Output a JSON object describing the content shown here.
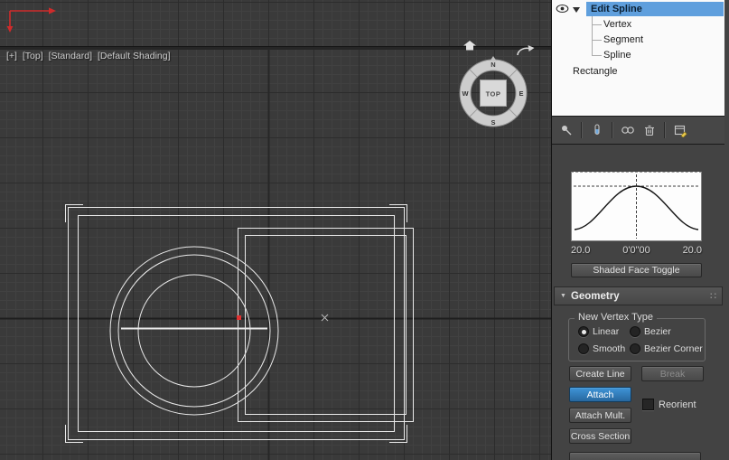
{
  "colors": {
    "viewport_bg": "#3a3a3a",
    "panel_bg": "#434343",
    "selection_blue": "#5f9fdd",
    "active_button_blue": "#2f7cbe",
    "wireframe": "#e9e9e9",
    "vertex_red": "#e03131"
  },
  "viewport": {
    "label_segments": [
      "[+]",
      "[Top]",
      "[Standard]",
      "[Default Shading]"
    ],
    "viewcube": {
      "face": "TOP",
      "west": "W",
      "east": "E",
      "south": "S",
      "north": "N"
    }
  },
  "modifier_stack": {
    "items": [
      {
        "label": "Edit Spline"
      },
      {
        "label": "Vertex"
      },
      {
        "label": "Segment"
      },
      {
        "label": "Spline"
      },
      {
        "label": "Rectangle"
      }
    ],
    "selected": "Edit Spline",
    "toolbar_icons": [
      "pin-stack",
      "show-end-result",
      "make-unique",
      "remove-modifier",
      "configure-modifier-sets"
    ]
  },
  "soft_selection": {
    "falloff_left": "20.0",
    "falloff_center": "0'0\"00",
    "falloff_right": "20.0",
    "shaded_face_toggle": "Shaded Face Toggle"
  },
  "geometry": {
    "title": "Geometry",
    "new_vertex_type": {
      "label": "New Vertex Type",
      "options": [
        "Linear",
        "Bezier",
        "Smooth",
        "Bezier Corner"
      ],
      "selected": "Linear"
    },
    "create_line": "Create Line",
    "break": "Break",
    "attach": "Attach",
    "reorient": "Reorient",
    "attach_mult": "Attach Mult.",
    "cross_section": "Cross Section"
  }
}
